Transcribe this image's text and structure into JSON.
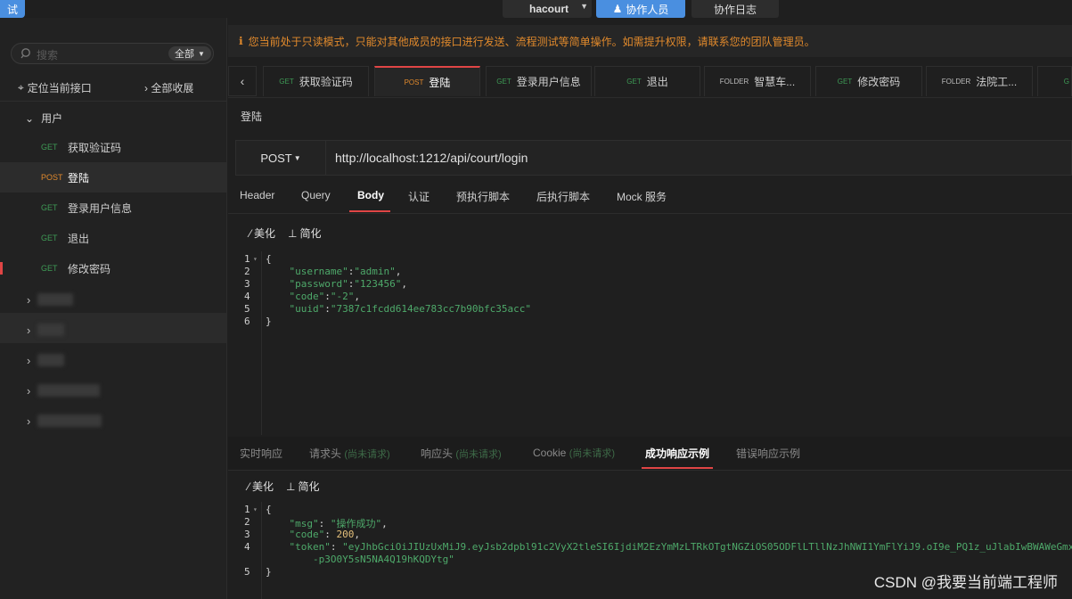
{
  "topbar": {
    "left_tag": "试",
    "project": "hacourt",
    "collab_button": "协作人员",
    "collab_log": "协作日志"
  },
  "sidebar": {
    "search_placeholder": "搜索",
    "filter": "全部",
    "locate_label": "定位当前接口",
    "collapse_label": "全部收展",
    "group_label": "用户",
    "items": [
      {
        "method": "GET",
        "label": "获取验证码"
      },
      {
        "method": "POST",
        "label": "登陆"
      },
      {
        "method": "GET",
        "label": "登录用户信息"
      },
      {
        "method": "GET",
        "label": "退出"
      },
      {
        "method": "GET",
        "label": "修改密码"
      }
    ]
  },
  "notice": "您当前处于只读模式，只能对其他成员的接口进行发送、流程测试等简单操作。如需提升权限，请联系您的团队管理员。",
  "tabs": [
    {
      "method": "GET",
      "label": "获取验证码"
    },
    {
      "method": "POST",
      "label": "登陆"
    },
    {
      "method": "GET",
      "label": "登录用户信息"
    },
    {
      "method": "GET",
      "label": "退出"
    },
    {
      "method": "FOLDER",
      "label": "智慧车..."
    },
    {
      "method": "GET",
      "label": "修改密码"
    },
    {
      "method": "FOLDER",
      "label": "法院工..."
    },
    {
      "method": "G",
      "label": ""
    }
  ],
  "request": {
    "title": "登陆",
    "method": "POST",
    "url": "http://localhost:1212/api/court/login",
    "tabs": [
      "Header",
      "Query",
      "Body",
      "认证",
      "预执行脚本",
      "后执行脚本",
      "Mock 服务"
    ],
    "active_tab": "Body",
    "beautify": "美化",
    "simplify": "简化",
    "body_lines": [
      {
        "n": "1",
        "text": "{"
      },
      {
        "n": "2",
        "key": "\"username\"",
        "val": "\"admin\"",
        "tail": ","
      },
      {
        "n": "3",
        "key": "\"password\"",
        "val": "\"123456\"",
        "tail": ","
      },
      {
        "n": "4",
        "key": "\"code\"",
        "val": "\"-2\"",
        "tail": ","
      },
      {
        "n": "5",
        "key": "\"uuid\"",
        "val": "\"7387c1fcdd614ee783cc7b90bfc35acc\"",
        "tail": ""
      },
      {
        "n": "6",
        "text": "}"
      }
    ]
  },
  "response": {
    "tabs": [
      {
        "label": "实时响应",
        "note": ""
      },
      {
        "label": "请求头",
        "note": "(尚未请求)"
      },
      {
        "label": "响应头",
        "note": "(尚未请求)"
      },
      {
        "label": "Cookie",
        "note": "(尚未请求)"
      },
      {
        "label": "成功响应示例",
        "note": ""
      },
      {
        "label": "错误响应示例",
        "note": ""
      }
    ],
    "beautify": "美化",
    "simplify": "简化",
    "lines": [
      {
        "n": "1",
        "text": "{"
      },
      {
        "n": "2",
        "key": "\"msg\"",
        "val": "\"操作成功\"",
        "tail": ","
      },
      {
        "n": "3",
        "key": "\"code\"",
        "num": "200",
        "tail": ","
      },
      {
        "n": "4",
        "key": "\"token\"",
        "val": "\"eyJhbGciOiJIUzUxMiJ9.eyJsb2dpbl91c2VyX2tleSI6IjdiM2EzYmMzLTRkOTgtNGZiOS05ODFlLTllNzJhNWI1YmFlYiJ9.oI9e_PQ1z_uJlabIwBWAWeGmxe",
        "tail": ""
      },
      {
        "n": "",
        "cont": "-p3O0Y5sN5NA4Q19hKQDYtg\""
      },
      {
        "n": "5",
        "text": "}"
      }
    ]
  },
  "watermark": "CSDN @我要当前端工程师"
}
